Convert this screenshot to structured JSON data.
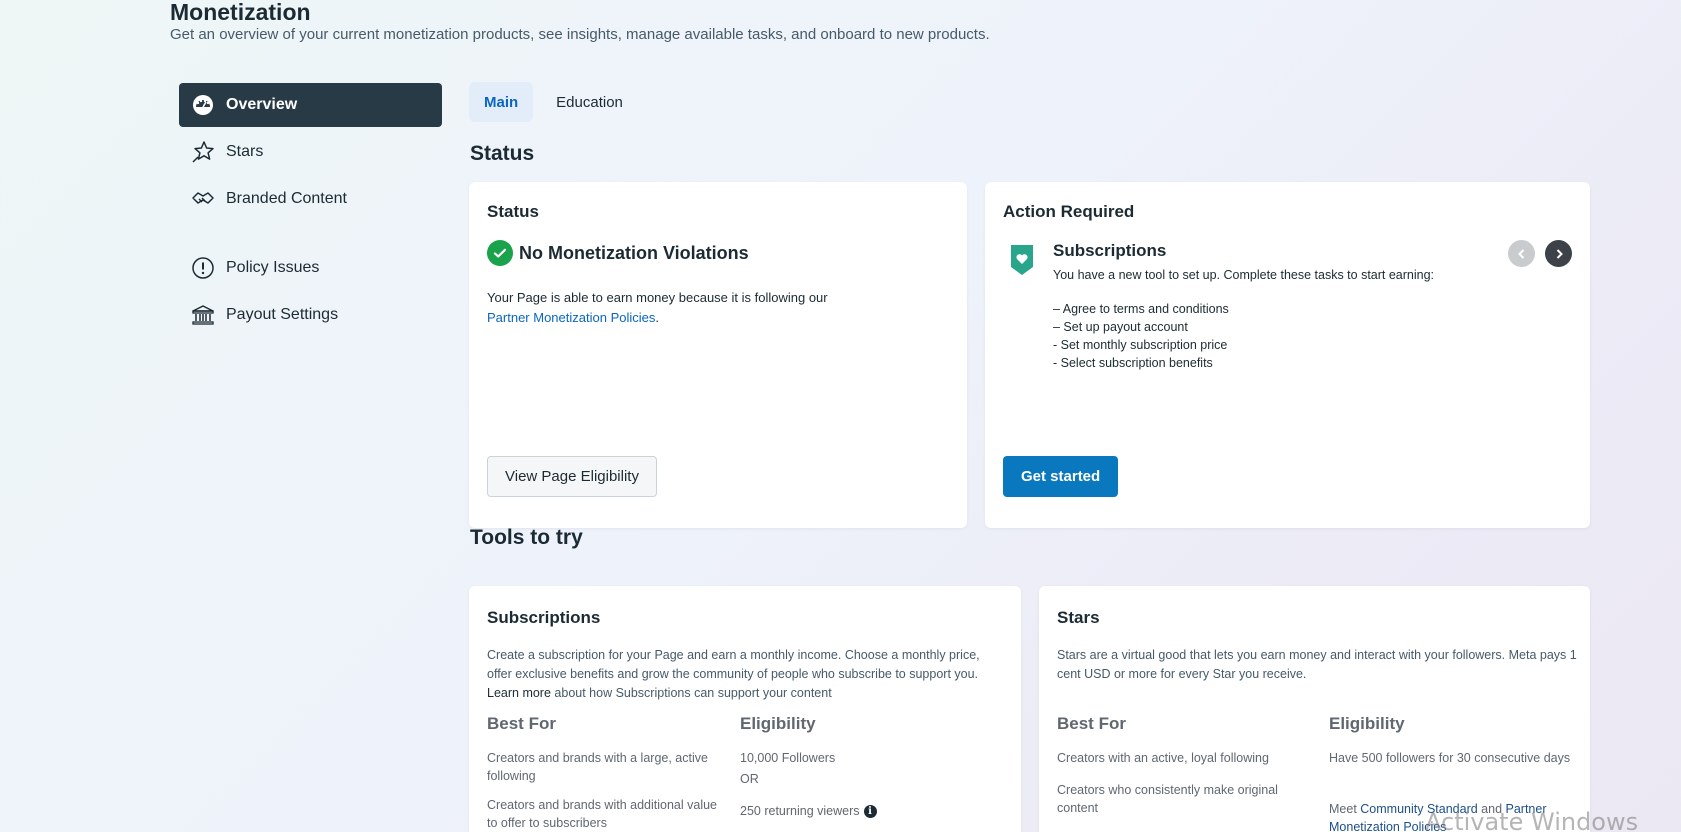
{
  "header": {
    "title": "Monetization",
    "subtitle": "Get an overview of your current monetization products, see insights, manage available tasks, and onboard to new products."
  },
  "sidebar": {
    "items": [
      {
        "label": "Overview",
        "icon": "dashboard-icon",
        "active": true
      },
      {
        "label": "Stars",
        "icon": "star-icon"
      },
      {
        "label": "Branded Content",
        "icon": "handshake-icon"
      },
      {
        "label": "Policy Issues",
        "icon": "alert-circle-icon"
      },
      {
        "label": "Payout Settings",
        "icon": "bank-icon"
      }
    ]
  },
  "tabs": [
    {
      "label": "Main",
      "active": true
    },
    {
      "label": "Education"
    }
  ],
  "status_section": {
    "title": "Status",
    "status_card": {
      "title": "Status",
      "headline": "No Monetization Violations",
      "text": "Your Page is able to earn money because it is following our",
      "link": "Partner Monetization Policies",
      "link_suffix": ".",
      "button": "View Page Eligibility"
    },
    "action_card": {
      "title": "Action Required",
      "product": "Subscriptions",
      "description": "You have a new tool to set up. Complete these tasks to start earning:",
      "tasks": [
        "– Agree to terms and conditions",
        "– Set up payout account",
        "- Set monthly subscription price",
        "- Select subscription benefits"
      ],
      "button": "Get started"
    }
  },
  "tools_section": {
    "title": "Tools to try",
    "subscriptions": {
      "title": "Subscriptions",
      "desc_before": "Create a subscription for your Page and earn a monthly income. Choose a monthly price, offer exclusive benefits and grow the community of people who subscribe to support you. ",
      "desc_link": "Learn more",
      "desc_after": " about how Subscriptions can support your content",
      "best_for_label": "Best For",
      "eligibility_label": "Eligibility",
      "best_for": [
        "Creators and brands with a large, active following",
        "Creators and brands with additional value to offer to subscribers"
      ],
      "eligibility": [
        "10,000 Followers",
        "OR",
        "250 returning viewers"
      ]
    },
    "stars": {
      "title": "Stars",
      "description": "Stars are a virtual good that lets you earn money and interact with your followers. Meta pays 1 cent USD or more for every Star you receive.",
      "best_for_label": "Best For",
      "eligibility_label": "Eligibility",
      "best_for": [
        "Creators with an active, loyal following",
        "Creators who consistently make original content"
      ],
      "eligibility_1": "Have 500 followers for 30 consecutive days",
      "eligibility_2_prefix": "Meet ",
      "eligibility_2_link1": "Community Standard",
      "eligibility_2_mid": " and ",
      "eligibility_2_link2": "Partner Monetization Policies"
    }
  },
  "watermark": "Activate Windows",
  "colors": {
    "accent": "#0a78be",
    "active_nav": "#283a45",
    "success": "#1aa34a",
    "link": "#0a66c2"
  }
}
